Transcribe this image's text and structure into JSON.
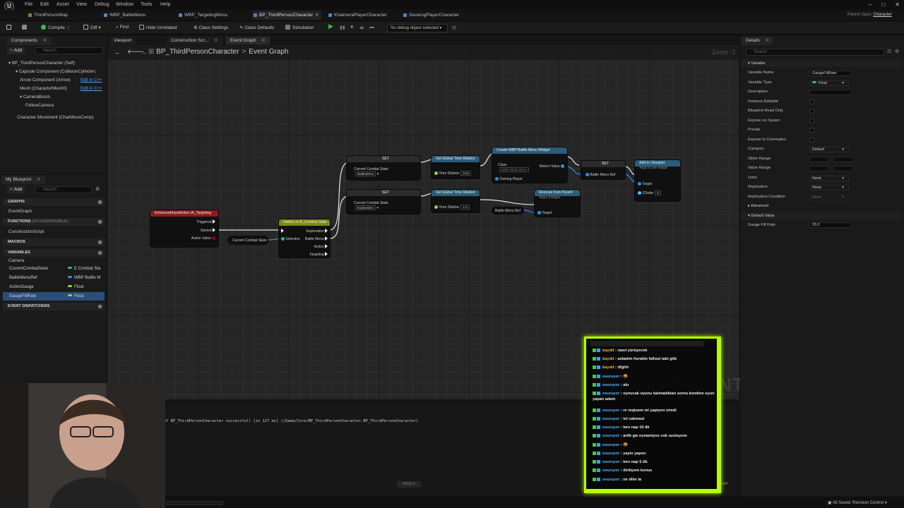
{
  "menu": [
    "File",
    "Edit",
    "Asset",
    "View",
    "Debug",
    "Window",
    "Tools",
    "Help"
  ],
  "window_tabs": [
    {
      "label": "ThirdPersonMap",
      "active": false
    },
    {
      "label": "WBP_BattleMenu",
      "active": false
    },
    {
      "label": "WBP_TargetingMenu",
      "active": false
    },
    {
      "label": "BP_ThirdPersonCharacter",
      "active": true
    },
    {
      "label": "KhaimeraPlayerCharacter",
      "active": false
    },
    {
      "label": "SevarogPlayerCharacter",
      "active": false
    }
  ],
  "parent_class": {
    "label": "Parent class:",
    "value": "Character"
  },
  "toolbar": {
    "compile": "Compile",
    "diff": "Diff",
    "find": "Find",
    "hide_unrelated": "Hide Unrelated",
    "class_settings": "Class Settings",
    "class_defaults": "Class Defaults",
    "simulation": "Simulation",
    "debug_object": "No debug object selected"
  },
  "components": {
    "tab": "Components",
    "add": "Add",
    "search_placeholder": "Search",
    "items": [
      {
        "label": "BP_ThirdPersonCharacter (Self)"
      },
      {
        "label": "Capsule Component (CollisionCylinder)"
      },
      {
        "label": "Arrow Component (Arrow)",
        "link": "Edit in C++"
      },
      {
        "label": "Mesh (CharacterMesh0)",
        "link": "Edit in C++"
      },
      {
        "label": "CameraBoom"
      },
      {
        "label": "FollowCamera"
      },
      {
        "label": "Character Movement (CharMoveComp)"
      }
    ]
  },
  "my_blueprint": {
    "tab": "My Blueprint",
    "add": "Add",
    "search_placeholder": "Search",
    "graphs_header": "GRAPHS",
    "event_graph": "EventGraph",
    "functions_header": "FUNCTIONS",
    "functions_overridable": "(34 OVERRIDABLE)",
    "construction_script": "ConstructionScript",
    "macros_header": "MACROS",
    "variables_header": "VARIABLES",
    "camera_group": "Camera",
    "variables": [
      {
        "name": "CurrentCombatState",
        "type": "E Combat Sta",
        "color": "#2fb38a",
        "selected": false
      },
      {
        "name": "BattleMenuRef",
        "type": "WBP Battle M",
        "color": "#2e8ef0",
        "selected": false
      },
      {
        "name": "ActionGauge",
        "type": "Float",
        "color": "#8fd14f",
        "selected": false
      },
      {
        "name": "GaugeFillRate",
        "type": "Float",
        "color": "#8fd14f",
        "selected": true
      }
    ],
    "event_dispatchers_header": "EVENT DISPATCHERS"
  },
  "editor_tabs": [
    "Viewport",
    "Construction Scr...",
    "Event Graph"
  ],
  "breadcrumb": {
    "root": "BP_ThirdPersonCharacter",
    "current": "Event Graph"
  },
  "zoom": "Zoom -2",
  "watermark": "BLUEPRINT",
  "nodes": {
    "input_action": {
      "title": "EnhancedInputAction IA_Targeting",
      "pins": [
        "Triggered",
        "Started",
        "Action Value"
      ]
    },
    "get_state": {
      "label": "Current Combat State"
    },
    "switch": {
      "title": "Switch on E_Combat State",
      "in_pins": [
        "Selection"
      ],
      "out_pins": [
        "Exploration",
        "Battle Menu",
        "Action",
        "Targeting"
      ]
    },
    "set1": {
      "title": "SET",
      "pin": "Current Combat State",
      "value": "BattleMenu"
    },
    "set2": {
      "title": "SET",
      "pin": "Current Combat State",
      "value": "Exploration"
    },
    "dilation1": {
      "title": "Set Global Time Dilation",
      "pin": "Time Dilation",
      "value": "0.01"
    },
    "dilation2": {
      "title": "Set Global Time Dilation",
      "pin": "Time Dilation",
      "value": "1.0"
    },
    "create_widget": {
      "title": "Create WBP Battle Menu Widget",
      "pins": [
        "Class",
        "Owning Player",
        "Return Value"
      ],
      "class_value": "WBP Battle Menu"
    },
    "set3": {
      "title": "SET",
      "pin": "Battle Menu Ref"
    },
    "add_viewport": {
      "title": "Add to Viewport",
      "subtitle": "Target is User Widget",
      "pins": [
        "Target",
        "ZOrder"
      ],
      "zorder": "0"
    },
    "remove_parent": {
      "title": "Remove from Parent",
      "subtitle": "Target is Widget",
      "pins": [
        "Target"
      ]
    },
    "battle_menu_ref": {
      "label": "Battle Menu Ref"
    }
  },
  "details": {
    "tab": "Details",
    "search_placeholder": "Search",
    "variable_header": "Variable",
    "rows": [
      {
        "label": "Variable Name",
        "value": "GaugeFillRate",
        "kind": "input"
      },
      {
        "label": "Variable Type",
        "value": "Float",
        "kind": "type"
      },
      {
        "label": "Description",
        "value": "",
        "kind": "input"
      },
      {
        "label": "Instance Editable",
        "kind": "check"
      },
      {
        "label": "Blueprint Read Only",
        "kind": "check"
      },
      {
        "label": "Expose on Spawn",
        "kind": "check"
      },
      {
        "label": "Private",
        "kind": "check"
      },
      {
        "label": "Expose to Cinematics",
        "kind": "check"
      },
      {
        "label": "Category",
        "value": "Default",
        "kind": "select"
      },
      {
        "label": "Slider Range",
        "kind": "range"
      },
      {
        "label": "Value Range",
        "kind": "range"
      },
      {
        "label": "Units",
        "value": "None",
        "kind": "select"
      },
      {
        "label": "Replication",
        "value": "None",
        "kind": "select"
      },
      {
        "label": "Replication Condition",
        "value": "None",
        "kind": "select"
      }
    ],
    "advanced": "Advanced",
    "default_value_header": "Default Value",
    "default_label": "Gauge Fill Rate",
    "default_value": "25.0"
  },
  "log": {
    "line": "of BP_ThirdPersonCharacter successful! [in 127 ms] (/Game/Core/BP_ThirdPersonCharacter.BP_ThirdPersonCharacter)",
    "page": "PAGE",
    "clear": "CLEAR"
  },
  "statusbar": {
    "all_saved": "All Saved",
    "revision": "Revision Control"
  },
  "chat": [
    {
      "user": "baydd",
      "text": "nasıl yürüyecek",
      "color": "u1"
    },
    {
      "user": "baydd",
      "text": "anladım heralde fallout taki giib",
      "color": "u1"
    },
    {
      "user": "baydd",
      "text": "dfghh",
      "color": "u1"
    },
    {
      "user": "osuruyor",
      "text": "🤬",
      "color": "u2"
    },
    {
      "user": "osuruyor",
      "text": "alu",
      "color": "u2"
    },
    {
      "user": "osuruyor",
      "text": "oynucak oyunu kalmadıktan sonra kendine oyun yapan adam",
      "color": "u2"
    },
    {
      "user": "osuruyor",
      "text": "re reqiuem mi yapiyon simdi",
      "color": "u2"
    },
    {
      "user": "osuruyor",
      "text": "lol cakmasi",
      "color": "u2"
    },
    {
      "user": "osuruyor",
      "text": "ben nap 10 dk",
      "color": "u2"
    },
    {
      "user": "osuruyor",
      "text": "artik gw oynamiyoz cok uzuluyom",
      "color": "u2"
    },
    {
      "user": "osuruyor",
      "text": "🤬",
      "color": "u2"
    },
    {
      "user": "osuruyor",
      "text": "yayin yapon",
      "color": "u2"
    },
    {
      "user": "osuruyor",
      "text": "ben nap 5 dk.",
      "color": "u2"
    },
    {
      "user": "osuruyor",
      "text": "dinliyom konus",
      "color": "u2"
    },
    {
      "user": "osuruyor",
      "text": "ne diiin la",
      "color": "u2"
    }
  ],
  "colors": {
    "accent": "#b6ff00",
    "selection": "#2b4d7b",
    "float_pin": "#8fd14f",
    "enum_pin": "#2fb38a",
    "object_pin": "#2e8ef0",
    "event_header": "#8a1c1c",
    "switch_header": "#7d8a14",
    "func_header": "#2a5d7a"
  }
}
